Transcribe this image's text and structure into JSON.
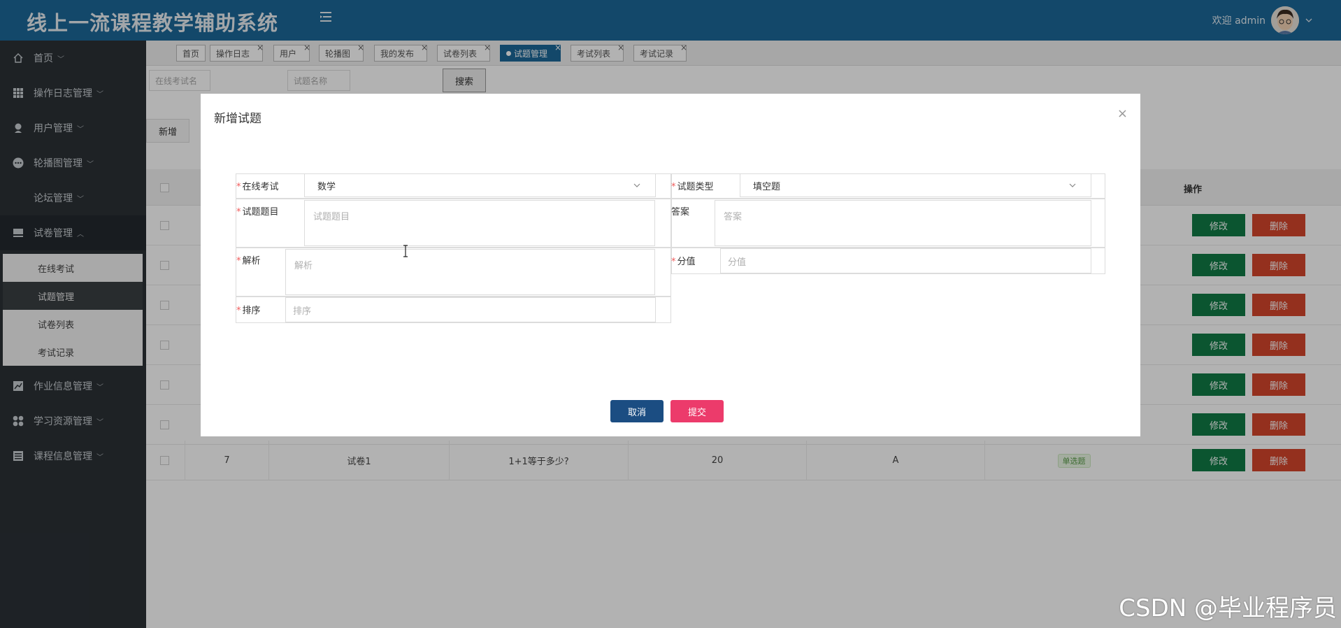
{
  "app": {
    "title": "线上一流课程教学辅助系统",
    "welcome": "欢迎 admin"
  },
  "sidebar": {
    "items": [
      {
        "label": "首页",
        "icon": "home-icon"
      },
      {
        "label": "操作日志管理",
        "icon": "grid-icon"
      },
      {
        "label": "用户管理",
        "icon": "user-icon"
      },
      {
        "label": "轮播图管理",
        "icon": "more-icon"
      },
      {
        "label": "论坛管理",
        "icon": ""
      },
      {
        "label": "试卷管理",
        "icon": "paper-icon"
      },
      {
        "label": "作业信息管理",
        "icon": "chart-icon"
      },
      {
        "label": "学习资源管理",
        "icon": "apps-icon"
      },
      {
        "label": "课程信息管理",
        "icon": "table-icon"
      }
    ],
    "submenu": [
      "在线考试",
      "试题管理",
      "试卷列表",
      "考试记录"
    ]
  },
  "tabs": [
    "首页",
    "操作日志",
    "用户",
    "轮播图",
    "我的发布",
    "试卷列表",
    "试题管理",
    "考试列表",
    "考试记录"
  ],
  "search": {
    "exam_placeholder": "在线考试名",
    "question_placeholder": "试题名称",
    "button": "搜索"
  },
  "toolbar": {
    "add": "新增"
  },
  "table": {
    "op_header": "操作",
    "edit": "修改",
    "delete": "删除",
    "last_row": {
      "id": "7",
      "paper": "试卷1",
      "question": "1+1等于多少?",
      "score": "20",
      "answer": "A",
      "type": "单选题"
    }
  },
  "dialog": {
    "title": "新增试题",
    "close": "×",
    "fields": {
      "exam_label": "在线考试",
      "exam_value": "数学",
      "type_label": "试题类型",
      "type_value": "填空题",
      "question_label": "试题题目",
      "question_placeholder": "试题题目",
      "answer_label": "答案",
      "answer_placeholder": "答案",
      "analysis_label": "解析",
      "analysis_placeholder": "解析",
      "score_label": "分值",
      "score_placeholder": "分值",
      "sort_label": "排序",
      "sort_placeholder": "排序"
    },
    "cancel": "取消",
    "submit": "提交"
  },
  "watermark": "CSDN @毕业程序员",
  "colors": {
    "header": "#1c6798",
    "sidebar": "#2b3136",
    "edit": "#107a46",
    "delete": "#d5462c",
    "cancel": "#1b4d82",
    "submit": "#ec3b6b"
  }
}
